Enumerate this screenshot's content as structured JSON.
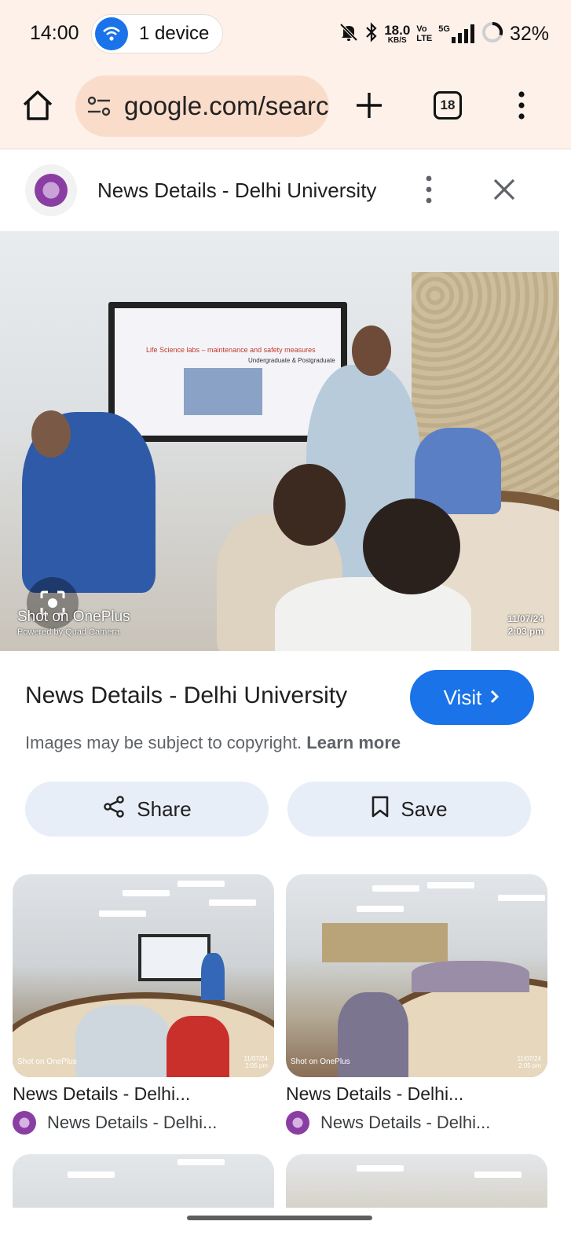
{
  "status_bar": {
    "time": "14:00",
    "device_label": "1 device",
    "net_speed_value": "18.0",
    "net_speed_unit": "KB/S",
    "volte_top": "Vo",
    "volte_bottom": "LTE",
    "network": "5G",
    "battery": "32%"
  },
  "toolbar": {
    "url": "google.com/search",
    "tab_count": "18"
  },
  "header": {
    "title": "News Details - Delhi University"
  },
  "main_image": {
    "watermark": "Shot on OnePlus",
    "watermark_sub": "Powered by Quad Camera",
    "date": "11/07/24",
    "time": "2:03 pm",
    "slide_title": "Life Science labs – maintenance and safety measures",
    "slide_subtitle": "Undergraduate & Postgraduate"
  },
  "result": {
    "title": "News Details - Delhi University",
    "visit_label": "Visit",
    "copyright_text": "Images may be subject to copyright.",
    "learn_more": "Learn more",
    "share_label": "Share",
    "save_label": "Save"
  },
  "related": [
    {
      "title": "News Details - Delhi...",
      "source": "News Details - Delhi...",
      "watermark": "Shot on OnePlus",
      "date": "11/07/24",
      "time": "2:05 pm"
    },
    {
      "title": "News Details - Delhi...",
      "source": "News Details - Delhi...",
      "watermark": "Shot on OnePlus",
      "date": "11/07/24",
      "time": "2:05 pm"
    }
  ],
  "colors": {
    "accent": "#1a73e8",
    "toolbar_bg": "#fdf1ea",
    "url_bar_bg": "#fadccb",
    "action_button_bg": "#e8eef8"
  }
}
